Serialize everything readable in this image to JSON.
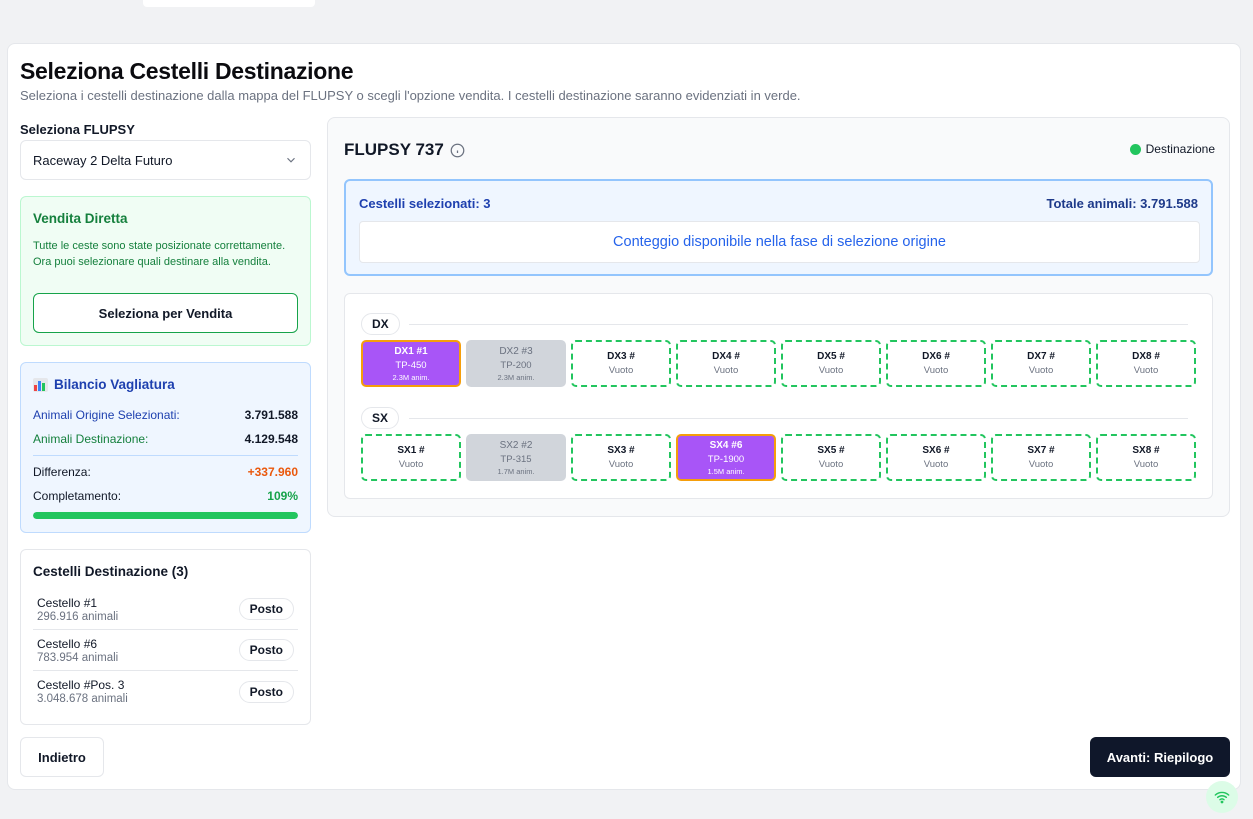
{
  "page": {
    "title": "Seleziona Cestelli Destinazione",
    "subtitle": "Seleziona i cestelli destinazione dalla mappa del FLUPSY o scegli l'opzione vendita. I cestelli destinazione saranno evidenziati in verde."
  },
  "flupsy_select": {
    "label": "Seleziona FLUPSY",
    "value": "Raceway 2 Delta Futuro"
  },
  "vendita": {
    "title": "Vendita Diretta",
    "text": "Tutte le ceste sono state posizionate correttamente. Ora puoi selezionare quali destinare alla vendita.",
    "button": "Seleziona per Vendita"
  },
  "bilancio": {
    "title": "Bilancio Vagliatura",
    "rows": [
      {
        "label": "Animali Origine Selezionati:",
        "value": "3.791.588"
      },
      {
        "label": "Animali Destinazione:",
        "value": "4.129.548"
      },
      {
        "label": "Differenza:",
        "value": "+337.960"
      },
      {
        "label": "Completamento:",
        "value": "109%"
      }
    ],
    "progress": 1.0,
    "colors": {
      "difference": "#ea580c",
      "complete": "#16a34a",
      "bar": "#22c55e"
    }
  },
  "destinazione": {
    "title": "Cestelli Destinazione (3)",
    "items": [
      {
        "name": "Cestello #1",
        "animals": "296.916 animali",
        "tag": "Posto"
      },
      {
        "name": "Cestello #6",
        "animals": "783.954 animali",
        "tag": "Posto"
      },
      {
        "name": "Cestello #Pos. 3",
        "animals": "3.048.678 animali",
        "tag": "Posto"
      }
    ]
  },
  "nav": {
    "back": "Indietro",
    "next": "Avanti: Riepilogo"
  },
  "flupsy": {
    "title": "FLUPSY 737",
    "legend": "Destinazione",
    "selected_count": "Cestelli selezionati: 3",
    "total_animals": "Totale animali: 3.791.588",
    "message": "Conteggio disponibile nella fase di selezione origine",
    "rows": [
      {
        "label": "DX",
        "cells": [
          {
            "state": "sel",
            "l1": "DX1 #1",
            "l2": "TP-450",
            "l3": "2.3M anim."
          },
          {
            "state": "occ",
            "l1": "DX2 #3",
            "l2": "TP-200",
            "l3": "2.3M anim."
          },
          {
            "state": "empty",
            "l1": "DX3 #",
            "l2": "Vuoto",
            "l3": ""
          },
          {
            "state": "empty",
            "l1": "DX4 #",
            "l2": "Vuoto",
            "l3": ""
          },
          {
            "state": "empty",
            "l1": "DX5 #",
            "l2": "Vuoto",
            "l3": ""
          },
          {
            "state": "empty",
            "l1": "DX6 #",
            "l2": "Vuoto",
            "l3": ""
          },
          {
            "state": "empty",
            "l1": "DX7 #",
            "l2": "Vuoto",
            "l3": ""
          },
          {
            "state": "empty",
            "l1": "DX8 #",
            "l2": "Vuoto",
            "l3": ""
          }
        ]
      },
      {
        "label": "SX",
        "cells": [
          {
            "state": "empty",
            "l1": "SX1 #",
            "l2": "Vuoto",
            "l3": ""
          },
          {
            "state": "occ",
            "l1": "SX2 #2",
            "l2": "TP-315",
            "l3": "1.7M anim."
          },
          {
            "state": "empty",
            "l1": "SX3 #",
            "l2": "Vuoto",
            "l3": ""
          },
          {
            "state": "sel",
            "l1": "SX4 #6",
            "l2": "TP-1900",
            "l3": "1.5M anim."
          },
          {
            "state": "empty",
            "l1": "SX5 #",
            "l2": "Vuoto",
            "l3": ""
          },
          {
            "state": "empty",
            "l1": "SX6 #",
            "l2": "Vuoto",
            "l3": ""
          },
          {
            "state": "empty",
            "l1": "SX7 #",
            "l2": "Vuoto",
            "l3": ""
          },
          {
            "state": "empty",
            "l1": "SX8 #",
            "l2": "Vuoto",
            "l3": ""
          }
        ]
      }
    ]
  }
}
